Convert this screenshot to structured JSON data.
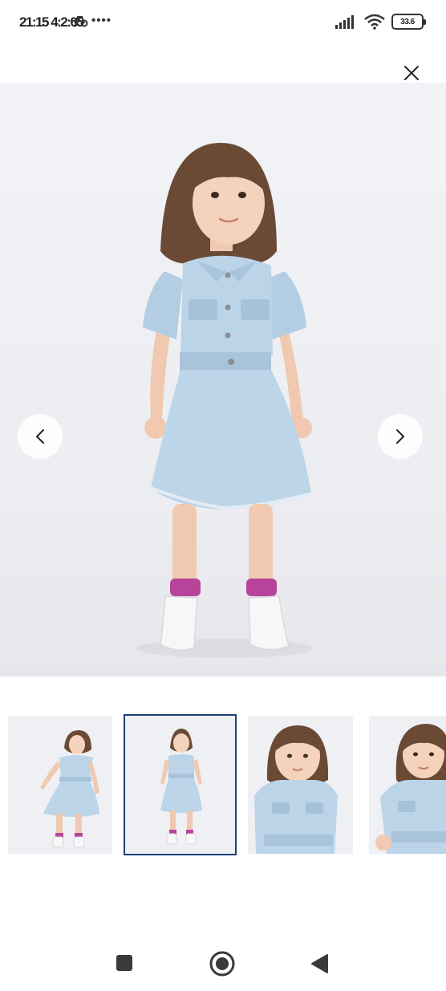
{
  "status_bar": {
    "time": "21:15 4:2:05",
    "signal_icon": "signal-bars-icon",
    "wifi_icon": "wifi-icon",
    "battery_level": "33%",
    "battery_label": "33.6",
    "notification_icon": "bike-icon",
    "more_dots": "••••"
  },
  "viewer": {
    "close_icon": "close-icon",
    "prev_icon": "chevron-left-icon",
    "next_icon": "chevron-right-icon",
    "main_image": "child-denim-dress-full-length-front",
    "thumbnails": [
      {
        "image": "child-denim-dress-full-length-wide",
        "selected": false
      },
      {
        "image": "child-denim-dress-full-length-front",
        "selected": true
      },
      {
        "image": "child-denim-dress-upper-body",
        "selected": false
      },
      {
        "image": "child-denim-dress-upper-body-angle",
        "selected": false
      }
    ]
  },
  "navbar": {
    "recents_icon": "square-icon",
    "home_icon": "circle-home-icon",
    "back_icon": "triangle-back-icon"
  },
  "colors": {
    "accent_border": "#1e3f7a",
    "denim": "#b8d0e4",
    "sock_pink": "#b8449a"
  }
}
